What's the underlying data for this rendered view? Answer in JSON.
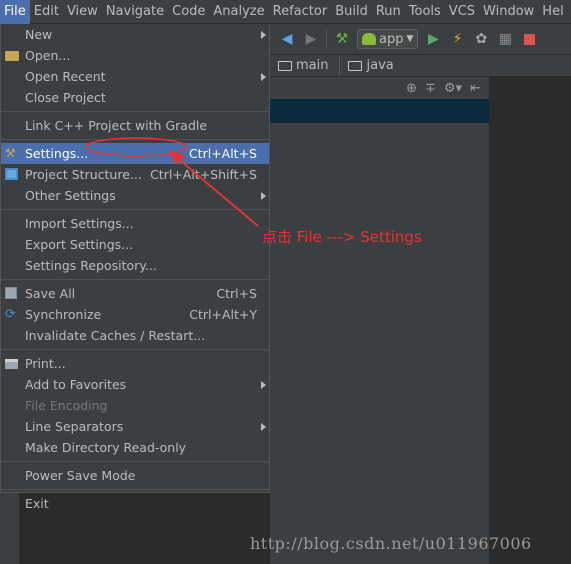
{
  "menubar": [
    "File",
    "Edit",
    "View",
    "Navigate",
    "Code",
    "Analyze",
    "Refactor",
    "Build",
    "Run",
    "Tools",
    "VCS",
    "Window",
    "Hel"
  ],
  "toolbar": {
    "run_config": "app"
  },
  "breadcrumbs": [
    "main",
    "java"
  ],
  "file_menu": {
    "groups": [
      [
        {
          "label": "New",
          "submenu": true
        },
        {
          "label": "Open...",
          "icon": "folder-icon"
        },
        {
          "label": "Open Recent",
          "submenu": true
        },
        {
          "label": "Close Project"
        }
      ],
      [
        {
          "label": "Link C++ Project with Gradle"
        }
      ],
      [
        {
          "label": "Settings...",
          "shortcut": "Ctrl+Alt+S",
          "icon": "wrench-icon",
          "selected": true
        },
        {
          "label": "Project Structure...",
          "shortcut": "Ctrl+Alt+Shift+S",
          "icon": "project-structure-icon"
        },
        {
          "label": "Other Settings",
          "submenu": true
        }
      ],
      [
        {
          "label": "Import Settings..."
        },
        {
          "label": "Export Settings..."
        },
        {
          "label": "Settings Repository..."
        }
      ],
      [
        {
          "label": "Save All",
          "shortcut": "Ctrl+S",
          "icon": "save-icon"
        },
        {
          "label": "Synchronize",
          "shortcut": "Ctrl+Alt+Y",
          "icon": "sync-icon"
        },
        {
          "label": "Invalidate Caches / Restart..."
        }
      ],
      [
        {
          "label": "Print...",
          "icon": "print-icon"
        },
        {
          "label": "Add to Favorites",
          "submenu": true
        },
        {
          "label": "File Encoding",
          "disabled": true
        },
        {
          "label": "Line Separators",
          "submenu": true
        },
        {
          "label": "Make Directory Read-only"
        }
      ],
      [
        {
          "label": "Power Save Mode"
        }
      ],
      [
        {
          "label": "Exit"
        }
      ]
    ]
  },
  "annotation": {
    "text": "点击 File ---> Settings"
  },
  "watermark": "http://blog.csdn.net/u011967006",
  "colors": {
    "menu_bg": "#3c3f41",
    "selection": "#4b6eaf",
    "annotation": "#e53333"
  }
}
